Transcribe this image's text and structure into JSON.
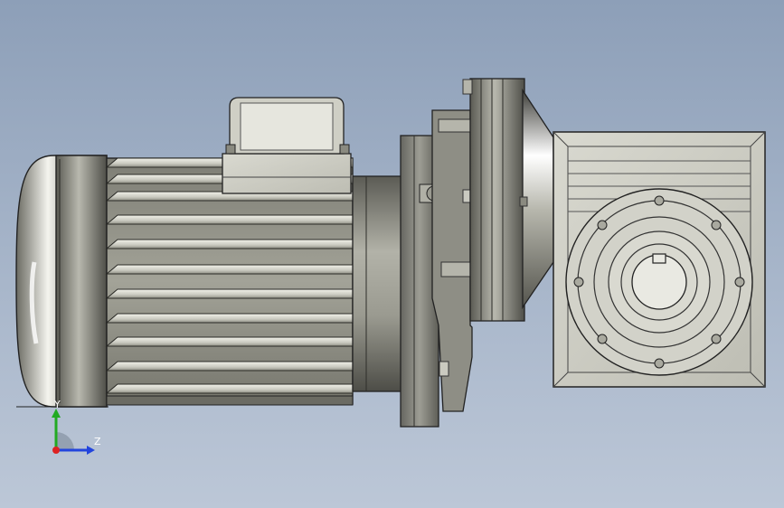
{
  "viewport": {
    "background_top": "#8d9fb8",
    "background_bottom": "#bcc7d7"
  },
  "model": {
    "body_color": "#8f8f86",
    "metal_light": "#d8d8cf",
    "metal_dark": "#3f3f3a",
    "outline": "#222222"
  },
  "triad": {
    "y_label": "Y",
    "z_label": "Z",
    "y_color": "#22aa22",
    "z_color": "#2244dd",
    "x_color": "#dd2222"
  }
}
